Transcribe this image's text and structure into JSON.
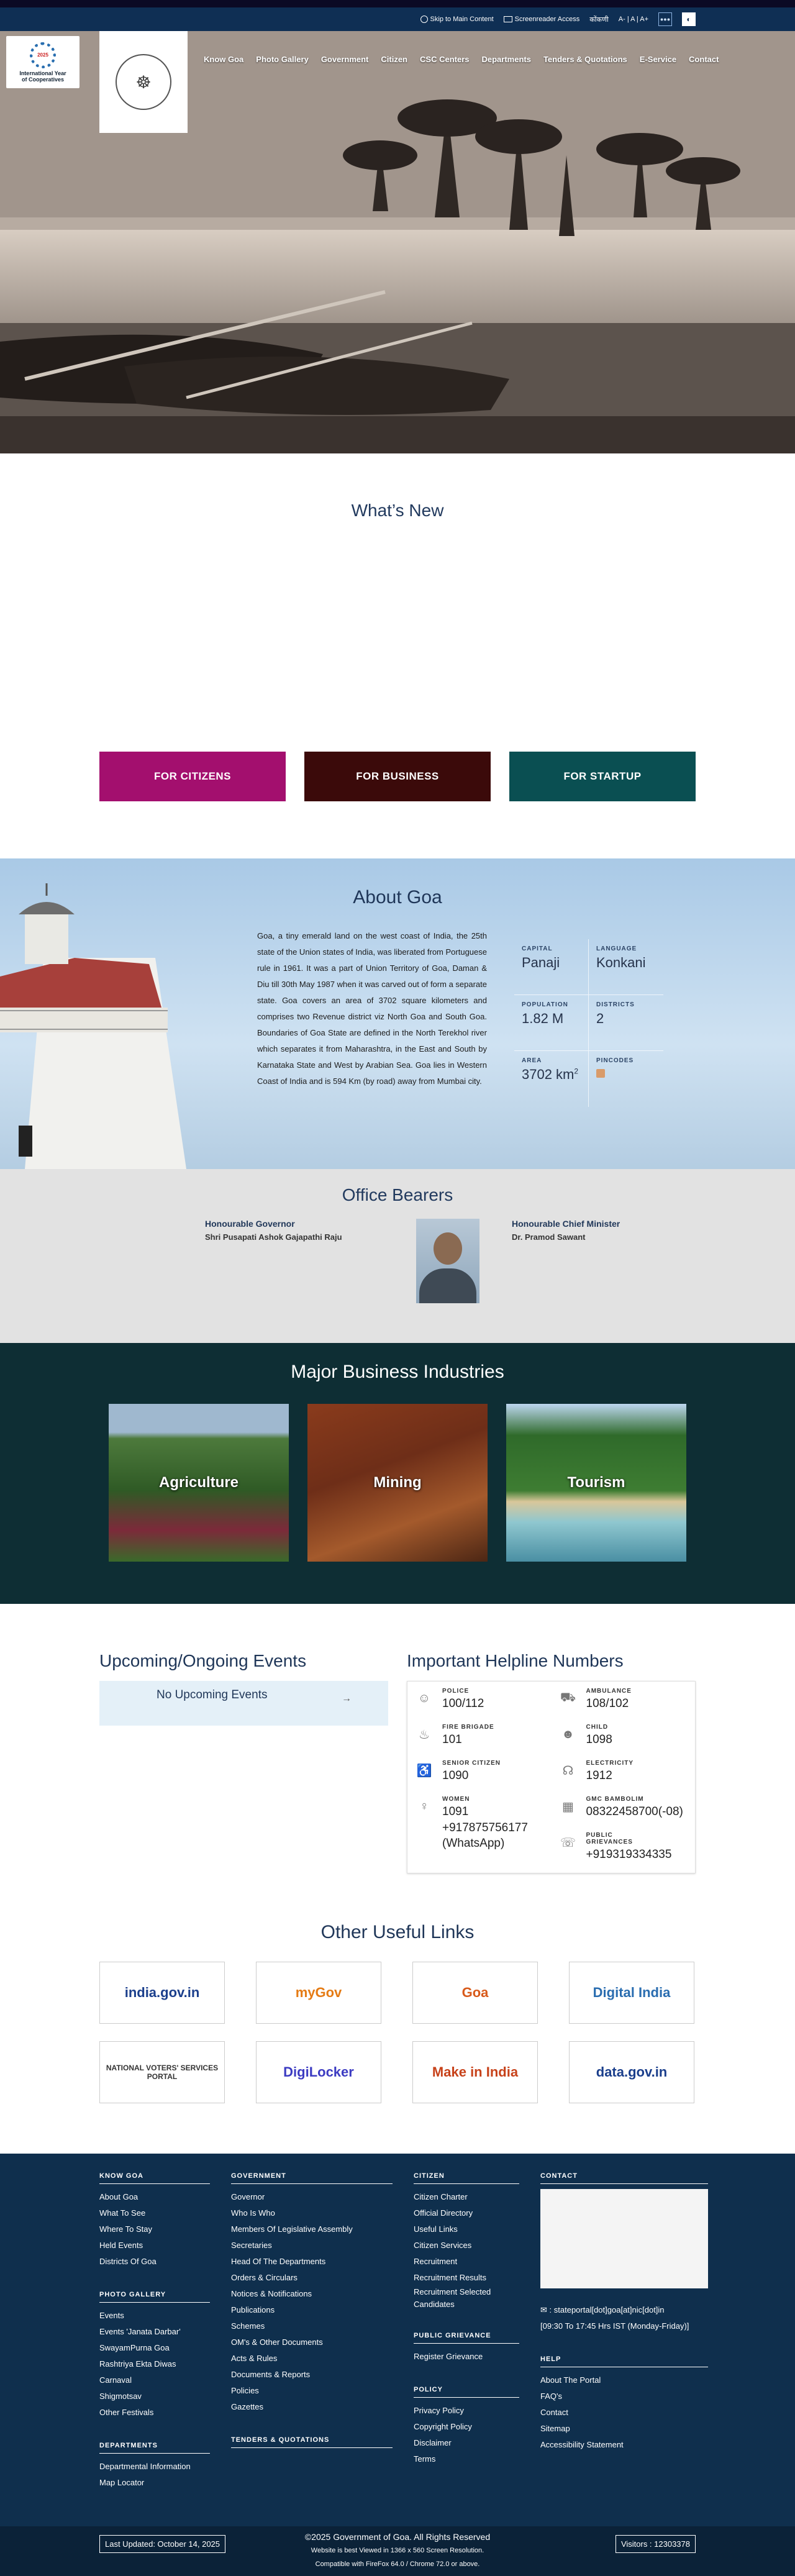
{
  "utility": {
    "skip": "Skip to Main Content",
    "screenreader": "Screenreader Access",
    "lang": "कोंकणी",
    "fontsize": "A- | A | A+",
    "translate_icon": "translate-icon",
    "contrast_icon": "contrast-icon"
  },
  "logos": {
    "iyc_year": "2025",
    "iyc_line1": "International Year",
    "iyc_line2": "of Cooperatives"
  },
  "nav": [
    "Know Goa",
    "Photo Gallery",
    "Government",
    "Citizen",
    "CSC Centers",
    "Departments",
    "Tenders & Quotations",
    "E-Service",
    "Contact"
  ],
  "whats_new": {
    "title": "What’s New"
  },
  "cta": [
    {
      "label": "FOR CITIZENS",
      "color": "#a30f6e"
    },
    {
      "label": "FOR BUSINESS",
      "color": "#3b0a0a"
    },
    {
      "label": "FOR STARTUP",
      "color": "#0a4f52"
    }
  ],
  "about": {
    "title": "About Goa",
    "text": "Goa, a tiny emerald land on the west coast of India, the 25th state of the Union states of India, was liberated from Portuguese rule in 1961. It was a part of Union Territory of Goa, Daman & Diu till 30th May 1987 when it was carved out of form a separate state. Goa covers an area of 3702 square kilometers and comprises two Revenue district viz North Goa and South Goa. Boundaries of Goa State are defined in the North Terekhol river which separates it from Maharashtra, in the East and South by Karnataka State and West by Arabian Sea. Goa lies in Western Coast of India and is 594 Km (by road) away from Mumbai city.",
    "stats": [
      {
        "label": "CAPITAL",
        "value": "Panaji"
      },
      {
        "label": "LANGUAGE",
        "value": "Konkani"
      },
      {
        "label": "POPULATION",
        "value": "1.82 M"
      },
      {
        "label": "DISTRICTS",
        "value": "2"
      },
      {
        "label": "AREA",
        "value": "3702 km",
        "sup": "2"
      },
      {
        "label": "PINCODES",
        "value": ""
      }
    ]
  },
  "bearers": {
    "title": "Office Bearers",
    "governor_title": "Honourable Governor",
    "governor_name": "Shri Pusapati Ashok Gajapathi Raju",
    "cm_title": "Honourable Chief Minister",
    "cm_name": "Dr. Pramod Sawant"
  },
  "industries": {
    "title": "Major Business Industries",
    "items": [
      "Agriculture",
      "Mining",
      "Tourism"
    ]
  },
  "events": {
    "title": "Upcoming/Ongoing Events",
    "empty": "No Upcoming Events",
    "arrow": "→"
  },
  "helpline": {
    "title": "Important Helpline Numbers",
    "items": [
      {
        "name": "POLICE",
        "number": "100/112",
        "icon": "police-icon"
      },
      {
        "name": "AMBULANCE",
        "number": "108/102",
        "icon": "ambulance-icon"
      },
      {
        "name": "FIRE BRIGADE",
        "number": "101",
        "icon": "fire-icon"
      },
      {
        "name": "CHILD",
        "number": "1098",
        "icon": "child-icon"
      },
      {
        "name": "SENIOR CITIZEN",
        "number": "1090",
        "icon": "senior-citizen-icon"
      },
      {
        "name": "ELECTRICITY",
        "number": "1912",
        "icon": "electricity-icon"
      },
      {
        "name": "WOMEN",
        "number": "1091\n+917875756177\n(WhatsApp)",
        "icon": "women-icon"
      },
      {
        "name": "GMC BAMBOLIM",
        "number": "08322458700(-08)",
        "icon": "hospital-icon"
      },
      {
        "name": "",
        "number": "",
        "icon": ""
      },
      {
        "name": "PUBLIC GRIEVANCES",
        "number": "+919319334335",
        "icon": "grievance-icon"
      }
    ]
  },
  "links": {
    "title": "Other Useful Links",
    "items": [
      {
        "label": "india.gov.in",
        "color": "#1b3f8c"
      },
      {
        "label": "myGov",
        "color": "#e57b14"
      },
      {
        "label": "Goa",
        "color": "#d85a1a"
      },
      {
        "label": "Digital India",
        "color": "#2a6db0"
      },
      {
        "label": "NATIONAL VOTERS' SERVICES PORTAL",
        "color": "#333333"
      },
      {
        "label": "DigiLocker",
        "color": "#3d3cc2"
      },
      {
        "label": "Make in India",
        "color": "#c7421a"
      },
      {
        "label": "data.gov.in",
        "color": "#1b3f8c"
      }
    ]
  },
  "footer": {
    "know_goa": {
      "title": "KNOW GOA",
      "items": [
        "About Goa",
        "What To See",
        "Where To Stay",
        "Held Events",
        "Districts Of Goa"
      ]
    },
    "photo_gallery": {
      "title": "PHOTO GALLERY",
      "items": [
        "Events",
        "Events 'Janata Darbar'",
        "SwayamPurna Goa",
        "Rashtriya Ekta Diwas",
        "Carnaval",
        "Shigmotsav",
        "Other Festivals"
      ]
    },
    "departments": {
      "title": "DEPARTMENTS",
      "items": [
        "Departmental Information",
        "Map Locator"
      ]
    },
    "government": {
      "title": "GOVERNMENT",
      "items": [
        "Governor",
        "Who Is Who",
        "Members Of Legislative Assembly",
        "Secretaries",
        "Head Of The Departments",
        "Orders & Circulars",
        "Notices & Notifications",
        "Publications",
        "Schemes",
        "OM's & Other Documents",
        "Acts & Rules",
        "Documents & Reports",
        "Policies",
        "Gazettes"
      ]
    },
    "tenders": {
      "title": "TENDERS & QUOTATIONS"
    },
    "citizen": {
      "title": "CITIZEN",
      "items": [
        "Citizen Charter",
        "Official Directory",
        "Useful Links",
        "Citizen Services",
        "Recruitment",
        "Recruitment Results",
        "Recruitment Selected Candidates"
      ]
    },
    "grievance": {
      "title": "PUBLIC GRIEVANCE",
      "items": [
        "Register Grievance"
      ]
    },
    "policy": {
      "title": "POLICY",
      "items": [
        "Privacy Policy",
        "Copyright Policy",
        "Disclaimer",
        "Terms"
      ]
    },
    "contact": {
      "title": "CONTACT",
      "email": ": stateportal[dot]goa[at]nic[dot]in",
      "hours": "[09:30 To 17:45 Hrs IST (Monday-Friday)]"
    },
    "help": {
      "title": "HELP",
      "items": [
        "About The Portal",
        "FAQ's",
        "Contact",
        "Sitemap",
        "Accessibility Statement"
      ]
    }
  },
  "bottom": {
    "last_updated": "Last Updated: October 14, 2025",
    "copyright": "©2025 Government of Goa. All Rights Reserved",
    "best_viewed": "Website is best Viewed in 1366 x 560 Screen Resolution.",
    "compatible": "Compatible with FireFox 64.0 / Chrome 72.0 or above.",
    "visitors": "Visitors : 12303378"
  }
}
